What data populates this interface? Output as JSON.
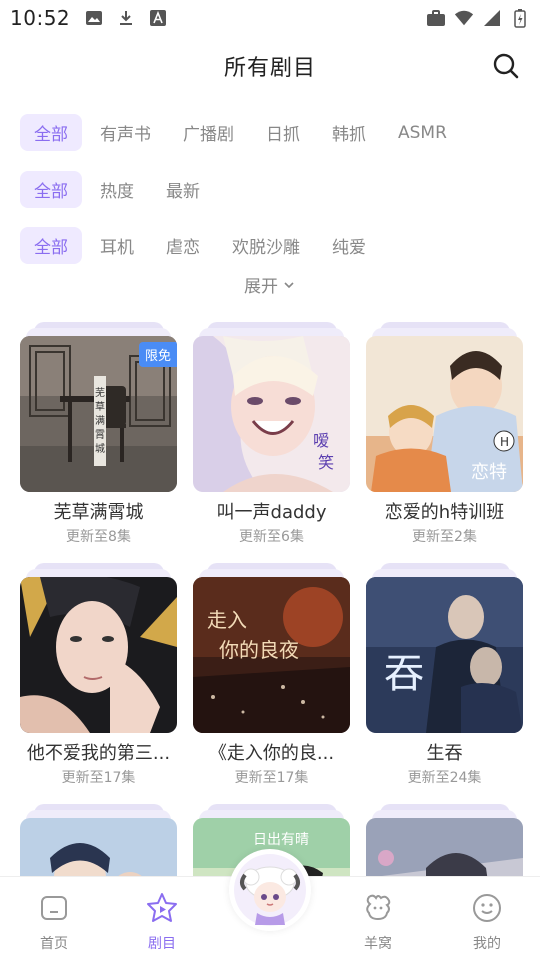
{
  "status_bar": {
    "time": "10:52"
  },
  "header": {
    "title": "所有剧目"
  },
  "filters": {
    "type": [
      "全部",
      "有声书",
      "广播剧",
      "日抓",
      "韩抓",
      "ASMR"
    ],
    "sort": [
      "全部",
      "热度",
      "最新"
    ],
    "tags": [
      "全部",
      "耳机",
      "虐恋",
      "欢脱沙雕",
      "纯爱"
    ],
    "expand_label": "展开"
  },
  "cards": [
    {
      "title": "芜草满霄城",
      "update": "更新至8集",
      "badge": "限免"
    },
    {
      "title": "叫一声daddy",
      "update": "更新至6集"
    },
    {
      "title": "恋爱的h特训班",
      "update": "更新至2集"
    },
    {
      "title": "他不爱我的第三...",
      "update": "更新至17集"
    },
    {
      "title": "《走入你的良...",
      "update": "更新至17集"
    },
    {
      "title": "生吞",
      "update": "更新至24集"
    },
    {
      "title": "",
      "update": ""
    },
    {
      "title": "",
      "update": ""
    },
    {
      "title": "",
      "update": ""
    }
  ],
  "nav": {
    "home": "首页",
    "dramas": "剧目",
    "nest": "羊窝",
    "mine": "我的"
  },
  "colors": {
    "accent": "#8a6df0",
    "chip_bg": "#efeaff",
    "badge": "#4a8cf5"
  }
}
